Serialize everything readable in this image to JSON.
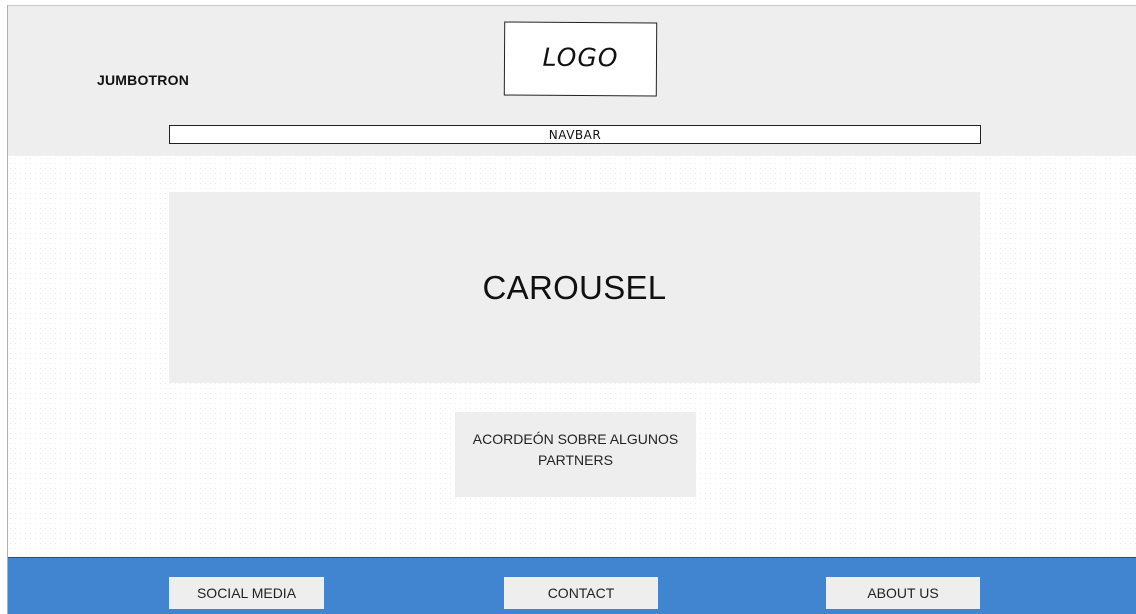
{
  "header": {
    "jumbotron_label": "JUMBOTRON",
    "logo_label": "LOGO",
    "navbar_label": "NAVBAR"
  },
  "main": {
    "carousel_label": "CAROUSEL",
    "accordion_label": "ACORDEÓN SOBRE ALGUNOS PARTNERS"
  },
  "footer": {
    "buttons": [
      {
        "label": "SOCIAL MEDIA"
      },
      {
        "label": "CONTACT"
      },
      {
        "label": "ABOUT US"
      }
    ]
  },
  "colors": {
    "placeholder_fill": "#eeeeee",
    "footer_background": "#4185d0",
    "outline": "#222222"
  }
}
